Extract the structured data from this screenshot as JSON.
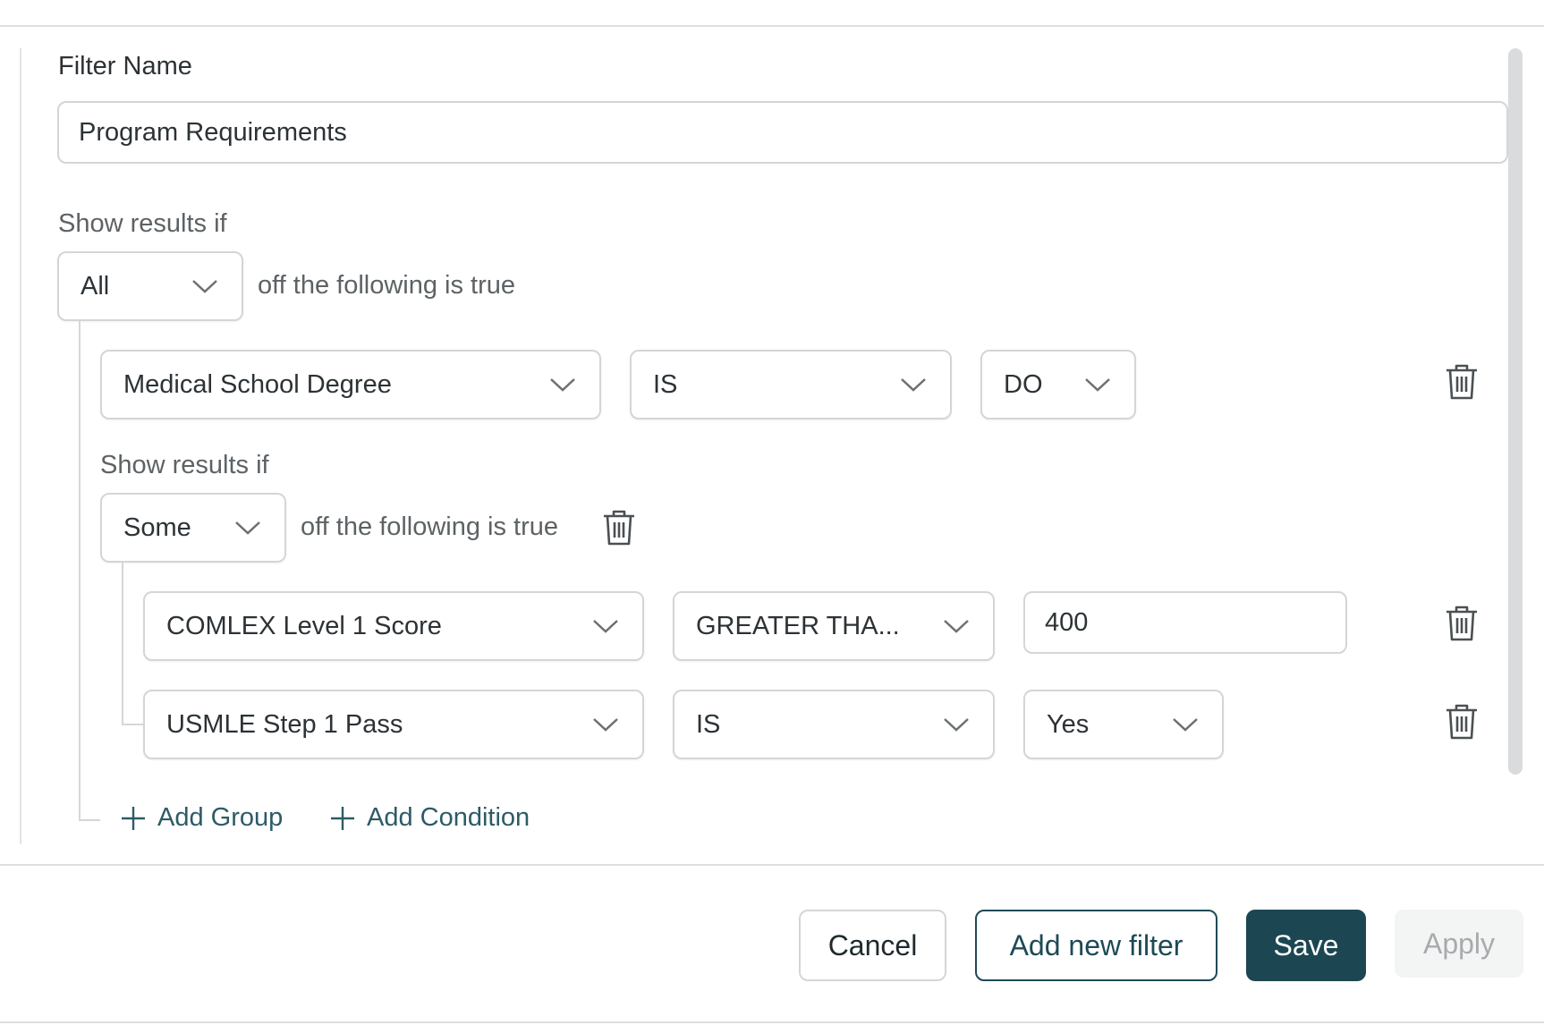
{
  "form": {
    "filter_name_label": "Filter Name",
    "filter_name_value": "Program Requirements",
    "show_results_label": "Show results if",
    "root_quantifier": "All",
    "following_true_text": "off the following is true",
    "conditions": [
      {
        "field": "Medical School Degree",
        "operator": "IS",
        "value": "DO"
      }
    ],
    "group": {
      "show_results_label": "Show results if",
      "quantifier": "Some",
      "following_true_text": "off the following is true",
      "conditions": [
        {
          "field": "COMLEX Level 1 Score",
          "operator": "GREATER THA...",
          "value": "400"
        },
        {
          "field": "USMLE Step 1 Pass",
          "operator": "IS",
          "value": "Yes"
        }
      ]
    },
    "add_group_label": "Add Group",
    "add_condition_label": "Add Condition"
  },
  "footer": {
    "cancel_label": "Cancel",
    "add_new_filter_label": "Add new filter",
    "save_label": "Save",
    "apply_label": "Apply"
  },
  "colors": {
    "primary": "#1c4752",
    "link": "#2d5b66",
    "border": "#d3d6d8",
    "disabled_bg": "#f3f4f4"
  },
  "icons": [
    "chevron-down-icon",
    "trash-icon",
    "plus-icon"
  ]
}
